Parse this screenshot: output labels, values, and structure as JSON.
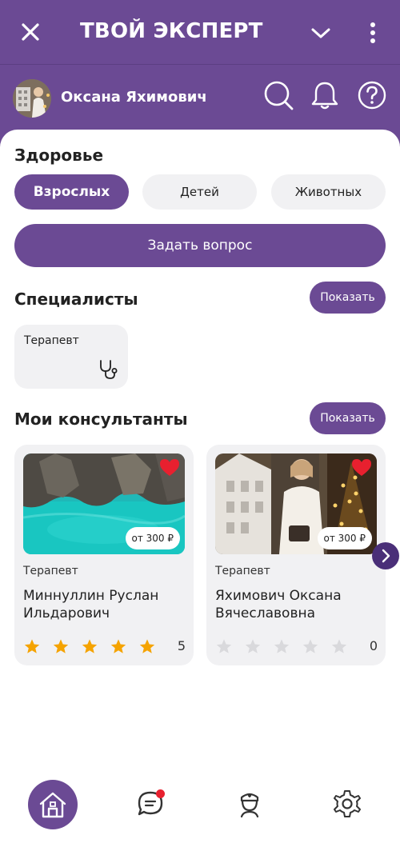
{
  "header": {
    "title": "ТВОЙ ЭКСПЕРТ"
  },
  "user": {
    "name": "Оксана Яхимович"
  },
  "health": {
    "title": "Здоровье",
    "tabs": [
      "Взрослых",
      "Детей",
      "Животных"
    ],
    "active_tab": "Взрослых",
    "ask_label": "Задать вопрос"
  },
  "specialists": {
    "title": "Специалисты",
    "show_label": "Показать",
    "items": [
      {
        "label": "Терапевт",
        "icon": "stethoscope-icon"
      }
    ]
  },
  "consultants": {
    "title": "Мои консультанты",
    "show_label": "Показать",
    "items": [
      {
        "specialty": "Терапевт",
        "name": "Миннуллин Руслан Ильдарович",
        "price": "от 300 ₽",
        "rating": 5,
        "rating_label": "5",
        "favorite": true
      },
      {
        "specialty": "Терапевт",
        "name": "Яхимович Оксана Вячеславовна",
        "price": "от 300 ₽",
        "rating": 0,
        "rating_label": "0",
        "favorite": true
      }
    ]
  },
  "nav": {
    "items": [
      "home-icon",
      "chat-icon",
      "doctor-icon",
      "settings-icon"
    ],
    "active": "home-icon",
    "chat_has_notification": true
  },
  "colors": {
    "brand": "#6b4a94",
    "star_active": "#f5a300",
    "star_inactive": "#d9d9dc",
    "heart": "#e8202f",
    "badge": "#e8202f"
  }
}
